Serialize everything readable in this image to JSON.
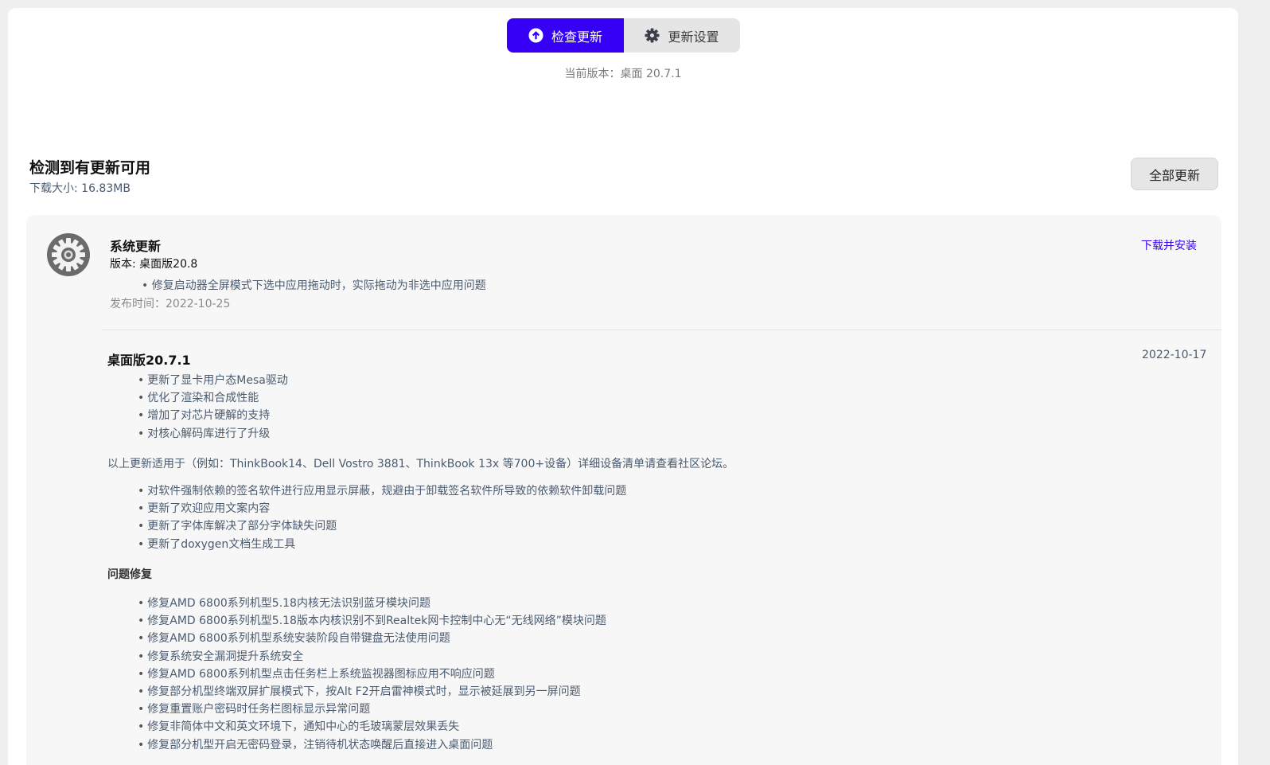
{
  "tabs": [
    {
      "label": "检查更新",
      "icon": "arrow-up-circle-icon",
      "active": true
    },
    {
      "label": "更新设置",
      "icon": "gear-icon",
      "active": false
    }
  ],
  "current_version": "当前版本：桌面 20.7.1",
  "header": {
    "title": "检测到有更新可用",
    "download_size": "下载大小: 16.83MB",
    "update_all_label": "全部更新"
  },
  "system_update": {
    "title": "系统更新",
    "version": "版本: 桌面版20.8",
    "notes": [
      "修复启动器全屏模式下选中应用拖动时，实际拖动为非选中应用问题"
    ],
    "release_date": "发布时间：2022-10-25",
    "action_label": "下载并安装"
  },
  "changelog": {
    "version": "桌面版20.7.1",
    "date": "2022-10-17",
    "items1": [
      "更新了显卡用户态Mesa驱动",
      "优化了渲染和合成性能",
      "增加了对芯片硬解的支持",
      "对核心解码库进行了升级"
    ],
    "paragraph": "以上更新适用于（例如：ThinkBook14、Dell Vostro 3881、ThinkBook 13x 等700+设备）详细设备清单请查看社区论坛。",
    "items2": [
      "对软件强制依赖的签名软件进行应用显示屏蔽，规避由于卸载签名软件所导致的依赖软件卸载问题",
      "更新了欢迎应用文案内容",
      "更新了字体库解决了部分字体缺失问题",
      "更新了doxygen文档生成工具"
    ],
    "fixes_title": "问题修复",
    "fixes": [
      "修复AMD 6800系列机型5.18内核无法识别蓝牙模块问题",
      "修复AMD 6800系列机型5.18版本内核识别不到Realtek网卡控制中心无“无线网络”模块问题",
      "修复AMD 6800系列机型系统安装阶段自带键盘无法使用问题",
      "修复系统安全漏洞提升系统安全",
      "修复AMD 6800系列机型点击任务栏上系统监视器图标应用不响应问题",
      "修复部分机型终端双屏扩展模式下，按Alt F2开启雷神模式时，显示被延展到另一屏问题",
      "修复重置账户密码时任务栏图标显示异常问题",
      "修复非简体中文和英文环境下，通知中心的毛玻璃蒙层效果丢失",
      "修复部分机型开启无密码登录，注销待机状态唤醒后直接进入桌面问题"
    ]
  }
}
